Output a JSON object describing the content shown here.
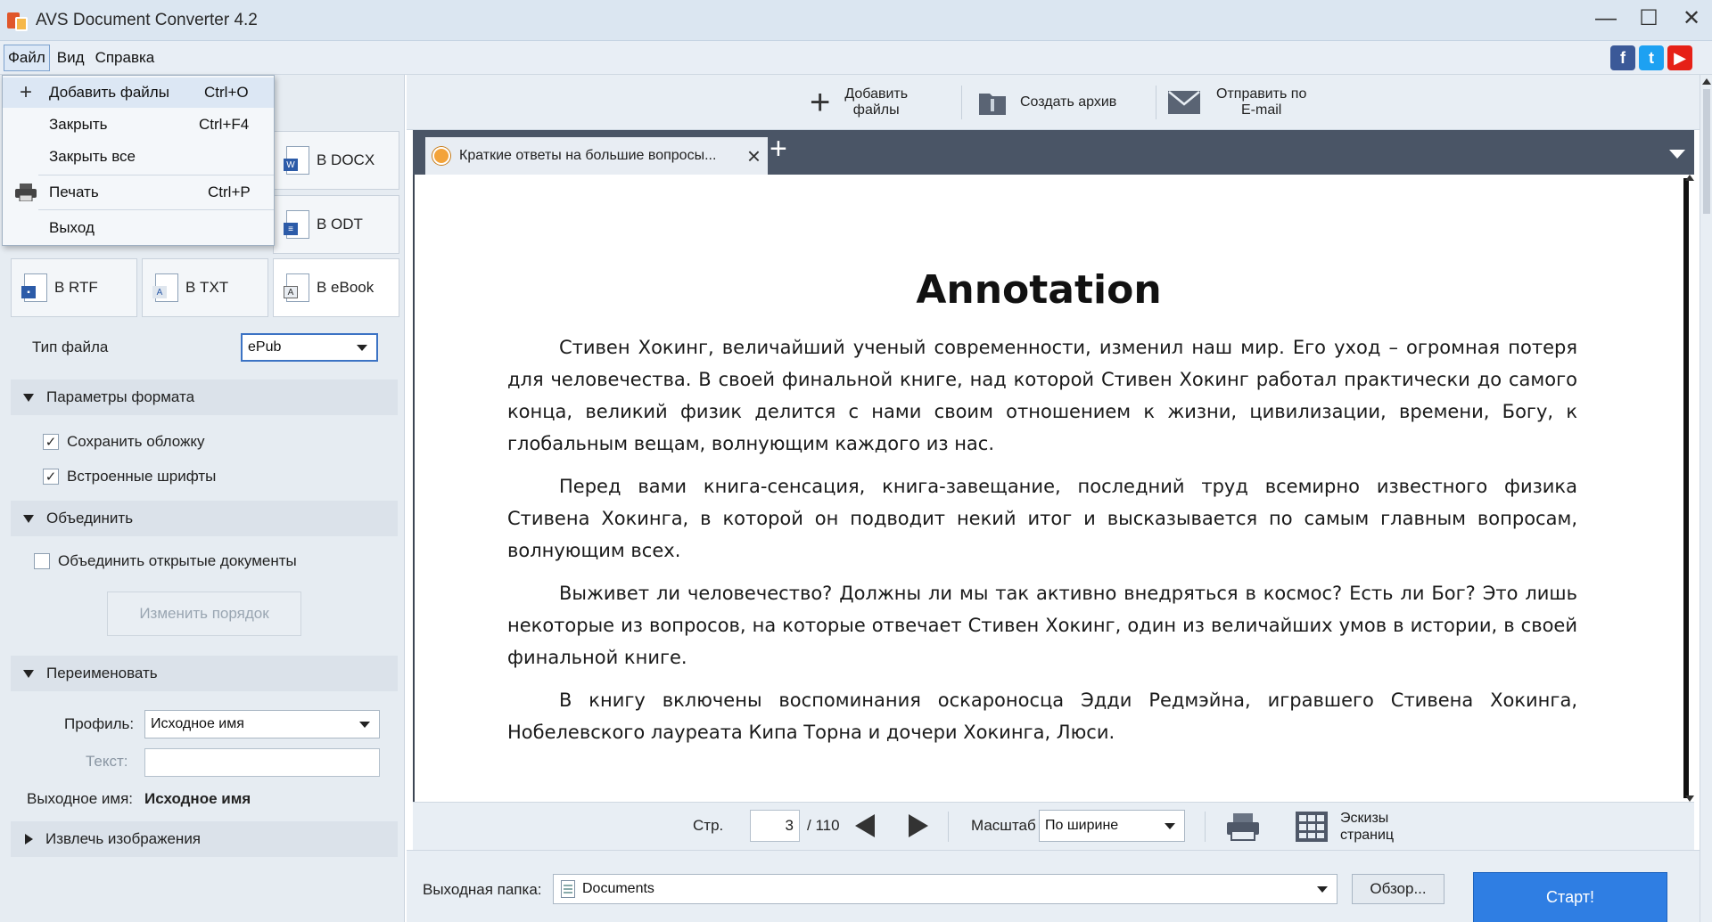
{
  "window": {
    "title": "AVS Document Converter 4.2",
    "minimize": "—",
    "maximize": "☐",
    "close": "✕"
  },
  "menubar": {
    "items": [
      "Файл",
      "Вид",
      "Справка"
    ]
  },
  "social": {
    "fb": "f",
    "tw": "t",
    "yt": "▶"
  },
  "file_menu": {
    "items": [
      {
        "label": "Добавить файлы",
        "shortcut": "Ctrl+O",
        "icon": "plus-icon"
      },
      {
        "label": "Закрыть",
        "shortcut": "Ctrl+F4"
      },
      {
        "label": "Закрыть все",
        "shortcut": ""
      },
      {
        "label": "Печать",
        "shortcut": "Ctrl+P",
        "icon": "printer-icon"
      },
      {
        "label": "Выход",
        "shortcut": ""
      }
    ]
  },
  "formats": {
    "docx": "В DOCX",
    "odt": "В ODT",
    "rtf": "В RTF",
    "txt": "В TXT",
    "ebook": "В eBook"
  },
  "file_type": {
    "label": "Тип файла",
    "value": "ePub"
  },
  "format_params": {
    "title": "Параметры формата",
    "save_cover": {
      "label": "Сохранить обложку",
      "checked": true
    },
    "embed_fonts": {
      "label": "Встроенные шрифты",
      "checked": true
    }
  },
  "merge": {
    "title": "Объединить",
    "merge_open": {
      "label": "Объединить открытые документы",
      "checked": false
    },
    "reorder_button": "Изменить порядок"
  },
  "rename": {
    "title": "Переименовать",
    "profile_label": "Профиль:",
    "profile_value": "Исходное имя",
    "text_label": "Текст:",
    "text_value": "",
    "output_label": "Выходное имя:",
    "output_value": "Исходное имя"
  },
  "extract_images": {
    "title": "Извлечь изображения"
  },
  "toolbar": {
    "add_files": "Добавить\nфайлы",
    "create_archive": "Создать архив",
    "send_email": "Отправить по\nE-mail"
  },
  "tab": {
    "title": "Краткие ответы на большие вопросы...",
    "close": "×",
    "add": "+"
  },
  "document": {
    "title": "Annotation",
    "paragraphs": [
      "Стивен Хокинг, величайший ученый современности, изменил наш мир. Его уход – огромная потеря для человечества. В своей финальной книге, над которой Стивен Хокинг работал практически до самого конца, великий физик делится с нами своим отношением к жизни, цивилизации, времени, Богу, к глобальным вещам, волнующим каждого из нас.",
      "Перед вами книга-сенсация, книга-завещание, последний труд всемирно известного физика Стивена Хокинга, в которой он подводит некий итог и высказывается по самым главным вопросам, волнующим всех.",
      "Выживет ли человечество? Должны ли мы так активно внедряться в космос? Есть ли Бог? Это лишь некоторые из вопросов, на которые отвечает Стивен Хокинг, один из величайших умов в истории, в своей финальной книге.",
      "В книгу включены воспоминания оскароносца Эдди Редмэйна, игравшего Стивена Хокинга, Нобелевского лауреата Кипа Торна и дочери Хокинга, Люси."
    ]
  },
  "page_nav": {
    "page_label": "Стр.",
    "current_page": "3",
    "total": "/ 110",
    "zoom_label": "Масштаб",
    "zoom_value": "По ширине",
    "thumbnails": "Эскизы\nстраниц"
  },
  "output": {
    "folder_label": "Выходная папка:",
    "folder_value": "Documents",
    "browse": "Обзор...",
    "start": "Старт!"
  }
}
